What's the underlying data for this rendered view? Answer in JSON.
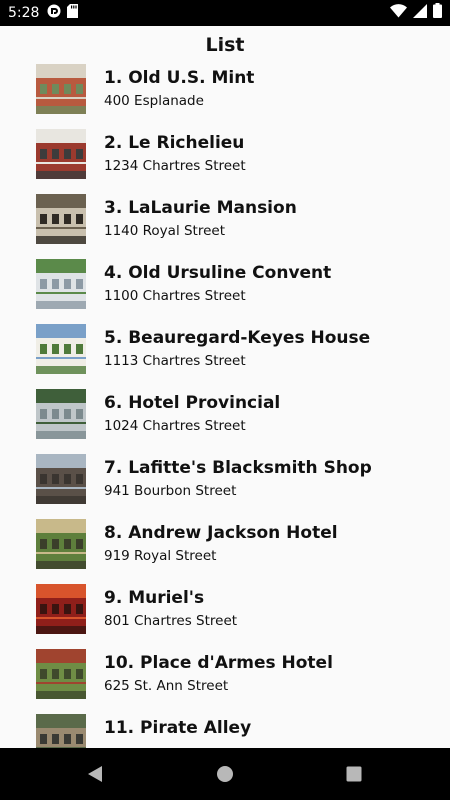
{
  "status_bar": {
    "time": "5:28",
    "icons": [
      "app-notification-icon",
      "sd-card-icon",
      "wifi-icon",
      "cellular-signal-icon",
      "battery-icon"
    ]
  },
  "title": "List",
  "items": [
    {
      "name": "1. Old U.S. Mint",
      "address": "400 Esplanade",
      "thumb": "old-us-mint-photo",
      "colors": [
        "#b85a3f",
        "#d9d2c4",
        "#6f8a5c"
      ]
    },
    {
      "name": "2. Le Richelieu",
      "address": "1234 Chartres Street",
      "thumb": "le-richelieu-photo",
      "colors": [
        "#9b3a2e",
        "#e8e6e0",
        "#3c3c3c"
      ]
    },
    {
      "name": "3. LaLaurie Mansion",
      "address": "1140 Royal Street",
      "thumb": "lalaurie-mansion-photo",
      "colors": [
        "#c9c0ae",
        "#6b6150",
        "#2f2a24"
      ]
    },
    {
      "name": "4. Old Ursuline Convent",
      "address": "1100 Chartres Street",
      "thumb": "old-ursuline-convent-photo",
      "colors": [
        "#dfe3e6",
        "#5b8a4a",
        "#8d9aa5"
      ]
    },
    {
      "name": "5. Beauregard-Keyes House",
      "address": "1113 Chartres Street",
      "thumb": "beauregard-keyes-house-photo",
      "colors": [
        "#f0eee6",
        "#7aa0c8",
        "#4f7a3a"
      ]
    },
    {
      "name": "6. Hotel Provincial",
      "address": "1024 Chartres Street",
      "thumb": "hotel-provincial-photo",
      "colors": [
        "#bfc6c9",
        "#3f5f3a",
        "#7c8a8e"
      ]
    },
    {
      "name": "7. Lafitte's Blacksmith Shop",
      "address": "941 Bourbon Street",
      "thumb": "lafittes-blacksmith-shop-photo",
      "colors": [
        "#5a5048",
        "#a9b6c2",
        "#3a3530"
      ]
    },
    {
      "name": "8. Andrew Jackson Hotel",
      "address": "919 Royal Street",
      "thumb": "andrew-jackson-hotel-photo",
      "colors": [
        "#5e7f3c",
        "#c8b98a",
        "#3b3f2a"
      ]
    },
    {
      "name": "9. Muriel's",
      "address": "801 Chartres Street",
      "thumb": "muriels-photo",
      "colors": [
        "#8f1f1a",
        "#d8542c",
        "#3a1410"
      ]
    },
    {
      "name": "10. Place d'Armes Hotel",
      "address": "625 St. Ann Street",
      "thumb": "place-darmes-hotel-photo",
      "colors": [
        "#6f8d45",
        "#a0442f",
        "#3f4a2c"
      ]
    },
    {
      "name": "11. Pirate Alley",
      "address": "",
      "thumb": "pirate-alley-photo",
      "colors": [
        "#9a8a70",
        "#5a6a4a",
        "#3a3a34"
      ]
    }
  ],
  "nav_bar": {
    "buttons": [
      "back-icon",
      "home-icon",
      "recents-icon"
    ]
  }
}
